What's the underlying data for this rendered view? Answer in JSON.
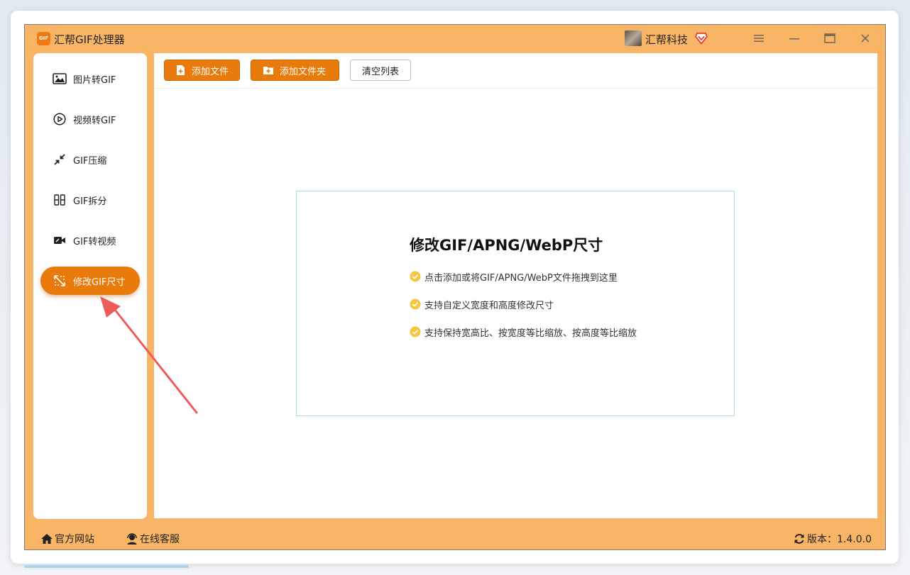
{
  "app": {
    "title": "汇帮GIF处理器",
    "logo_text": "GIF",
    "user_name": "汇帮科技",
    "accent_color": "#e97a0c",
    "frame_color": "#f8b566"
  },
  "sidebar": {
    "items": [
      {
        "label": "图片转GIF",
        "icon": "image-icon",
        "active": false
      },
      {
        "label": "视频转GIF",
        "icon": "play-icon",
        "active": false
      },
      {
        "label": "GIF压缩",
        "icon": "compress-icon",
        "active": false
      },
      {
        "label": "GIF拆分",
        "icon": "split-icon",
        "active": false
      },
      {
        "label": "GIF转视频",
        "icon": "video-camera-icon",
        "active": false
      },
      {
        "label": "修改GIF尺寸",
        "icon": "resize-icon",
        "active": true
      }
    ]
  },
  "toolbar": {
    "add_file_label": "添加文件",
    "add_folder_label": "添加文件夹",
    "clear_list_label": "清空列表"
  },
  "drop_zone": {
    "title": "修改GIF/APNG/WebP尺寸",
    "features": [
      "点击添加或将GIF/APNG/WebP文件拖拽到这里",
      "支持自定义宽度和高度修改尺寸",
      "支持保持宽高比、按宽度等比缩放、按高度等比缩放"
    ]
  },
  "statusbar": {
    "website_label": "官方网站",
    "support_label": "在线客服",
    "version_label": "版本：1.4.0.0"
  }
}
